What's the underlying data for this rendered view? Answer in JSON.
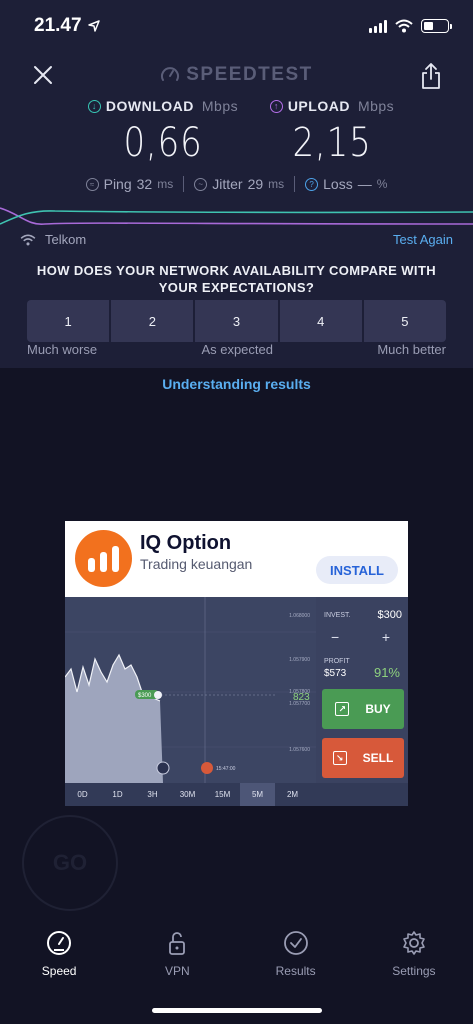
{
  "status_bar": {
    "time": "21.47"
  },
  "header": {
    "brand": "SPEEDTEST"
  },
  "download": {
    "label": "DOWNLOAD",
    "unit": "Mbps",
    "value": "0,66",
    "color": "#37c6b4"
  },
  "upload": {
    "label": "UPLOAD",
    "unit": "Mbps",
    "value": "2,15",
    "color": "#b36ee8"
  },
  "stats": {
    "ping_label": "Ping",
    "ping_value": "32",
    "ping_unit": "ms",
    "jitter_label": "Jitter",
    "jitter_value": "29",
    "jitter_unit": "ms",
    "loss_label": "Loss",
    "loss_value": "—",
    "loss_unit": "%"
  },
  "isp": {
    "name": "Telkom",
    "test_again": "Test Again"
  },
  "survey": {
    "question": "HOW DOES YOUR NETWORK AVAILABILITY COMPARE WITH YOUR EXPECTATIONS?",
    "options": [
      "1",
      "2",
      "3",
      "4",
      "5"
    ],
    "label_low": "Much worse",
    "label_mid": "As expected",
    "label_high": "Much better"
  },
  "understanding_link": "Understanding results",
  "ad": {
    "title": "IQ Option",
    "subtitle": "Trading keuangan",
    "install": "INSTALL",
    "invest_label": "INVEST.",
    "invest_value": "$300",
    "minus": "−",
    "plus": "+",
    "profit_label": "PROFIT",
    "profit_value": "$573",
    "profit_pct": "91%",
    "buy": "BUY",
    "sell": "SELL",
    "price": "823",
    "marker": "$300",
    "timer": "15:47:00",
    "tick_1": "1.068000",
    "tick_2": "1.057900",
    "tick_3": "1.057800",
    "tick_4": "1.057700",
    "tick_5": "1.057600",
    "timeframes": [
      "0D",
      "1D",
      "3H",
      "30M",
      "15M",
      "5M",
      "2M"
    ],
    "active_timeframe": "5M"
  },
  "ghost_badge": "GO",
  "tabs": [
    {
      "label": "Speed"
    },
    {
      "label": "VPN"
    },
    {
      "label": "Results"
    },
    {
      "label": "Settings"
    }
  ]
}
